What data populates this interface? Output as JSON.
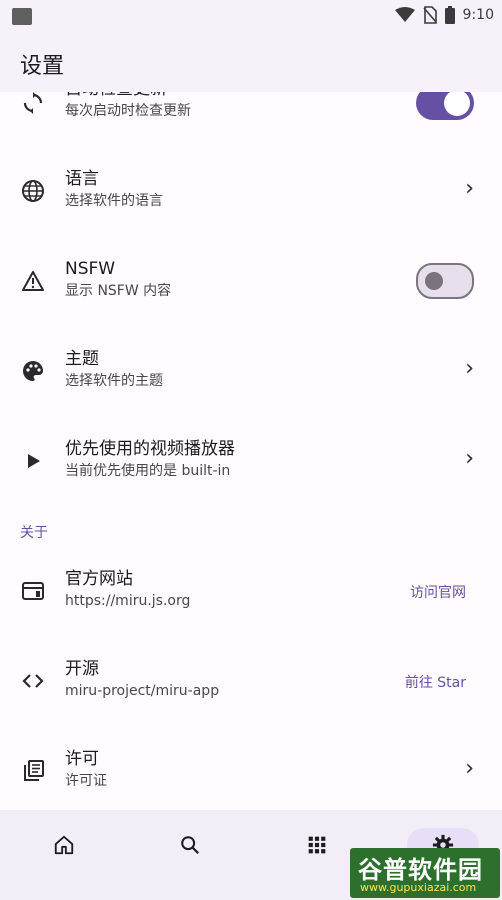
{
  "status": {
    "time": "9:10"
  },
  "appbar": {
    "title": "设置"
  },
  "settings": [
    {
      "title": "自动检查更新",
      "subtitle": "每次启动时检查更新",
      "control": "toggle-on",
      "icon": "sync-icon"
    },
    {
      "title": "语言",
      "subtitle": "选择软件的语言",
      "control": "chevron",
      "icon": "globe-icon"
    },
    {
      "title": "NSFW",
      "subtitle": "显示 NSFW 内容",
      "control": "toggle-off",
      "icon": "warning-icon"
    },
    {
      "title": "主题",
      "subtitle": "选择软件的主题",
      "control": "chevron",
      "icon": "palette-icon"
    },
    {
      "title": "优先使用的视频播放器",
      "subtitle": "当前优先使用的是 built-in",
      "control": "chevron",
      "icon": "play-icon"
    }
  ],
  "about_section": {
    "label": "关于"
  },
  "about": [
    {
      "title": "官方网站",
      "subtitle": "https://miru.js.org",
      "action": "访问官网",
      "icon": "web-icon"
    },
    {
      "title": "开源",
      "subtitle": "miru-project/miru-app",
      "action": "前往 Star",
      "icon": "code-icon"
    },
    {
      "title": "许可",
      "subtitle": "许可证",
      "action": "",
      "icon": "license-icon"
    }
  ],
  "chevron": "›",
  "bottom_nav": [
    "home-icon",
    "search-icon",
    "apps-icon",
    "settings-icon"
  ],
  "watermark": {
    "line1": "谷普软件园",
    "line2": "www.gupuxiazai.com"
  }
}
